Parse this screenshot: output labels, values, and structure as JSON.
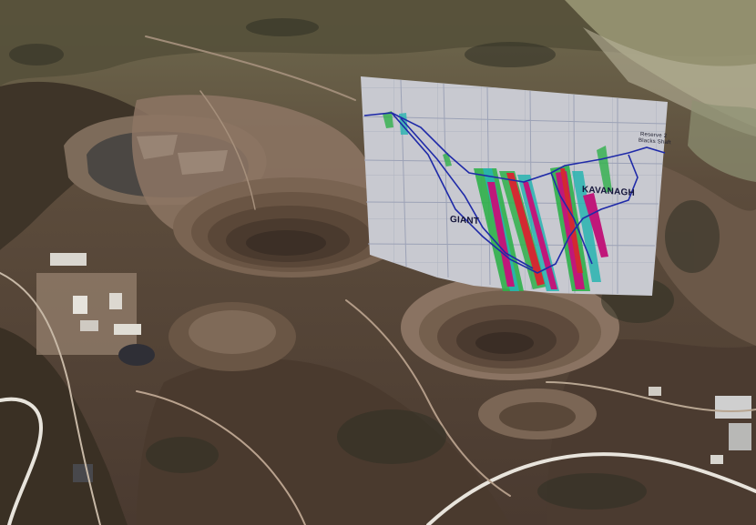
{
  "overlay": {
    "pit_labels": {
      "giant": "GIANT",
      "kavanagh": "KAVANAGH"
    },
    "legend_lines": {
      "line1": "Reserve 2",
      "line2": "Blacks Shaft"
    }
  },
  "colors": {
    "terrain_dark": "#3a2e26",
    "terrain_mid": "#6a5646",
    "terrain_light": "#9a8470",
    "pit_bench": "#8a7060",
    "vegetation": "#44402e",
    "section_bg": "#c8c9d0",
    "grid_line": "#9aa0b5",
    "pit_outline": "#1f2aa8",
    "ore_green": "#2fb04a",
    "ore_cyan": "#28b4b0",
    "ore_magenta": "#c0187a",
    "ore_red": "#d22a32",
    "road": "#e8e4dc"
  },
  "icons": {
    "aerial_map": "satellite-terrain-image",
    "section_overlay": "geological-cross-section-panel"
  }
}
